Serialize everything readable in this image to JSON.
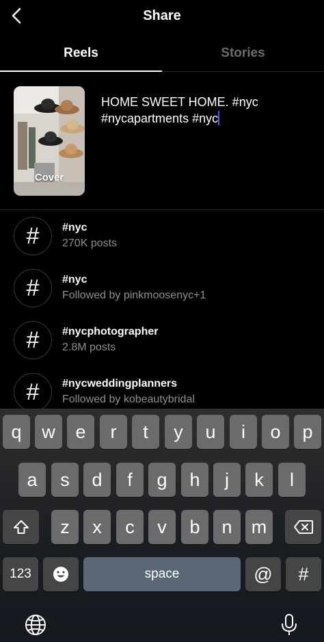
{
  "header": {
    "title": "Share",
    "back_icon": "chevron-left-icon"
  },
  "tabs": [
    {
      "label": "Reels",
      "active": true
    },
    {
      "label": "Stories",
      "active": false
    }
  ],
  "post": {
    "cover_label": "Cover",
    "caption_line1": "HOME SWEET HOME. #nyc",
    "caption_line2": "#nycapartments #nyc"
  },
  "suggestions": [
    {
      "tag": "#nyc",
      "detail": "270K posts"
    },
    {
      "tag": "#nyc",
      "detail": "Followed by pinkmoosenyc+1"
    },
    {
      "tag": "#nycphotographer",
      "detail": "2.8M posts"
    },
    {
      "tag": "#nycweddingplanners",
      "detail": "Followed by kobeautybridal"
    }
  ],
  "hash_symbol": "#",
  "keyboard": {
    "row1": [
      "q",
      "w",
      "e",
      "r",
      "t",
      "y",
      "u",
      "i",
      "o",
      "p"
    ],
    "row2": [
      "a",
      "s",
      "d",
      "f",
      "g",
      "h",
      "j",
      "k",
      "l"
    ],
    "row3": [
      "z",
      "x",
      "c",
      "v",
      "b",
      "n",
      "m"
    ],
    "numbers_key": "123",
    "space_key": "space",
    "at_key": "@",
    "hash_key": "#",
    "icons": [
      "shift-icon",
      "backspace-icon",
      "emoji-icon",
      "globe-icon",
      "microphone-icon"
    ]
  },
  "colors": {
    "background": "#000000",
    "cursor": "#2f6bff",
    "muted_text": "#8e8e8e"
  }
}
